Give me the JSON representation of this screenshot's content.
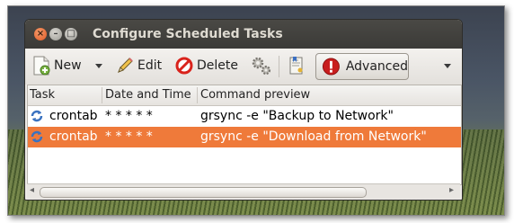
{
  "window": {
    "title": "Configure Scheduled Tasks",
    "controls": [
      "close",
      "minimize",
      "maximize"
    ]
  },
  "toolbar": {
    "new_label": "New",
    "edit_label": "Edit",
    "delete_label": "Delete",
    "advanced_label": "Advanced",
    "icons": {
      "new": "new-document-icon",
      "new_menu": "dropdown-arrow-icon",
      "edit": "pencil-icon",
      "delete": "delete-icon",
      "run": "gears-icon",
      "template": "template-icon",
      "advanced": "exclamation-icon",
      "overflow": "overflow-arrow-icon"
    },
    "colors": {
      "delete": "#d9231c",
      "advanced": "#c81d1d"
    }
  },
  "table": {
    "columns": [
      "Task",
      "Date and Time",
      "Command preview"
    ],
    "rows": [
      {
        "task": "crontab",
        "date_time": "* * * * *",
        "command": "grsync -e \"Backup to Network\"",
        "selected": false
      },
      {
        "task": "crontab",
        "date_time": "* * * * *",
        "command": "grsync -e \"Download from Network\"",
        "selected": true
      }
    ],
    "selection_color": "#ef7a3a",
    "row_icon": "refresh-icon"
  }
}
